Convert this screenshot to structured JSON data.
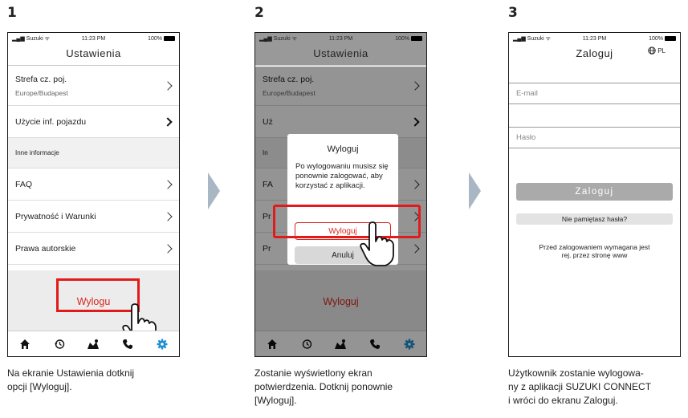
{
  "steps": [
    {
      "number": "1",
      "caption": [
        "Na ekranie Ustawienia dotknij",
        "opcji [Wyloguj]."
      ]
    },
    {
      "number": "2",
      "caption": [
        "Zostanie wyświetlony ekran",
        "potwierdzenia. Dotknij ponownie",
        "[Wyloguj]."
      ]
    },
    {
      "number": "3",
      "caption": [
        "Użytkownik zostanie wylogowa-",
        "ny z aplikacji SUZUKI CONNECT",
        "i wróci do ekranu Zaloguj."
      ]
    }
  ],
  "status_bar": {
    "carrier": "Suzuki",
    "time": "11:23 PM",
    "battery": "100%"
  },
  "settings": {
    "title": "Ustawienia",
    "timezone_label": "Strefa cz. poj.",
    "timezone_value": "Europe/Budapest",
    "vehicle_info": "Użycie inf. pojazdu",
    "vehicle_info_short": "Uż",
    "section_other": "Inne informacje",
    "section_other_short": "In",
    "faq": "FAQ",
    "faq_short": "FA",
    "privacy": "Prywatność i Warunki",
    "privacy_short": "Pr",
    "copyright": "Prawa autorskie",
    "copyright_short": "Pr",
    "logout": "Wyloguj",
    "logout_partial": "Wylogu"
  },
  "dialog": {
    "title": "Wyloguj",
    "message": [
      "Po wylogowaniu musisz się",
      "ponownie zalogować, aby",
      "korzystać z aplikacji."
    ],
    "confirm": "Wyloguj",
    "cancel": "Anuluj"
  },
  "login": {
    "title": "Zaloguj",
    "language": "PL",
    "email_placeholder": "E-mail",
    "password_placeholder": "Hasło",
    "login_button": "Zaloguj",
    "forgot_button": "Nie pamiętasz hasła?",
    "note": [
      "Przed zalogowaniem wymagana jest",
      "rej. przez stronę www"
    ]
  },
  "nav_icons": [
    "home-icon",
    "history-icon",
    "map-icon",
    "phone-icon",
    "gear-icon"
  ],
  "colors": {
    "accent_red": "#d9261c",
    "highlight_red": "#e11b1b",
    "nav_active": "#1e8ed0",
    "arrow": "#a9b6c4"
  }
}
